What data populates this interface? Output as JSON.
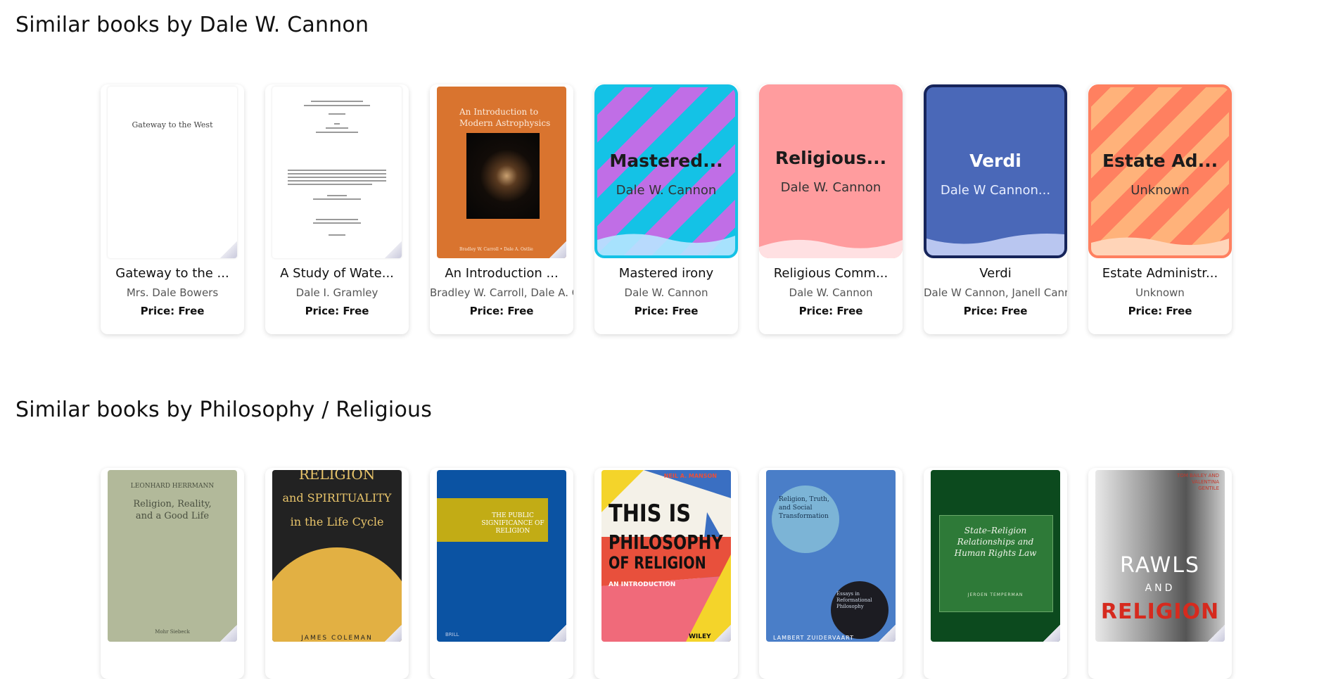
{
  "section1": {
    "title": "Similar books by Dale W. Cannon",
    "books": [
      {
        "title": "Gateway to the ...",
        "author": "Mrs. Dale Bowers",
        "price": "Price: Free",
        "cover_text": "Gateway to the West"
      },
      {
        "title": "A Study of Wate...",
        "author": "Dale I. Gramley",
        "price": "Price: Free"
      },
      {
        "title": "An Introduction ...",
        "author": "Bradley W. Carroll, Dale A. Ostlie",
        "price": "Price: Free",
        "cover_title": "An Introduction to Modern Astrophysics",
        "cover_authors": "Bradley W. Carroll • Dale A. Ostlie"
      },
      {
        "title": "Mastered irony",
        "author": "Dale W. Cannon",
        "price": "Price: Free",
        "cover_title": "Mastered...",
        "cover_author": "Dale W. Cannon"
      },
      {
        "title": "Religious Comm...",
        "author": "Dale W. Cannon",
        "price": "Price: Free",
        "cover_title": "Religious...",
        "cover_author": "Dale W. Cannon"
      },
      {
        "title": "Verdi",
        "author": "Dale W Cannon, Janell Cannon",
        "price": "Price: Free",
        "cover_title": "Verdi",
        "cover_author": "Dale W Cannon..."
      },
      {
        "title": "Estate Administr...",
        "author": "Unknown",
        "price": "Price: Free",
        "cover_title": "Estate Ad...",
        "cover_author": "Unknown"
      }
    ]
  },
  "section2": {
    "title": "Similar books by Philosophy / Religious",
    "books": [
      {
        "cover_author": "LEONHARD HERRMANN",
        "cover_title": "Religion, Reality, and a Good Life",
        "cover_publisher": "Mohr Siebeck"
      },
      {
        "cover_title_1": "RELIGION",
        "cover_title_2": "and SPIRITUALITY",
        "cover_title_3": "in the Life Cycle",
        "cover_author": "JAMES COLEMAN"
      },
      {
        "cover_title": "THE PUBLIC SIGNIFICANCE OF RELIGION",
        "cover_publisher": "BRILL"
      },
      {
        "cover_author": "NEIL A. MANSON",
        "cover_title_1": "THIS IS",
        "cover_title_2": "PHILOSOPHY",
        "cover_title_3": "OF RELIGION",
        "cover_subtitle": "AN INTRODUCTION",
        "cover_publisher": "WILEY"
      },
      {
        "cover_title": "Religion, Truth, and Social Transformation",
        "cover_subtitle": "Essays in Reformational Philosophy",
        "cover_author": "LAMBERT ZUIDERVAART"
      },
      {
        "cover_title": "State–Religion Relationships and Human Rights Law",
        "cover_author": "JEROEN TEMPERMAN"
      },
      {
        "cover_author": "TOM BAILEY AND VALENTINA GENTILE",
        "cover_title_1": "RAWLS",
        "cover_title_2": "AND",
        "cover_title_3": "RELIGION"
      }
    ]
  },
  "colors": {
    "mastered_bg": "#14c2e6",
    "religious_bg": "#ff9c9e",
    "verdi_bg": "#4a68b8",
    "estate_bg": "#ff8060"
  }
}
